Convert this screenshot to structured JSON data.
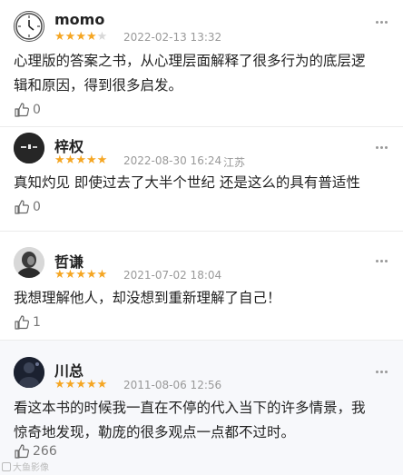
{
  "reviews": [
    {
      "user": "momo",
      "avatar_icon": "clock-icon",
      "rating": 4,
      "date": "2022-02-13 13:32",
      "location": "",
      "text_lines": [
        "心理版的答案之书，从心理层面解释了很多行为的底层逻",
        "辑和原因，得到很多启发。"
      ],
      "likes": "0"
    },
    {
      "user": "梓权",
      "avatar_icon": "dark-photo-avatar",
      "rating": 5,
      "date": "2022-08-30 16:24",
      "location": "江苏",
      "text_lines": [
        "真知灼见 即使过去了大半个世纪 还是这么的具有普适性"
      ],
      "likes": "0"
    },
    {
      "user": "哲谦",
      "avatar_icon": "portrait-avatar",
      "rating": 5,
      "date": "2021-07-02 18:04",
      "location": "",
      "text_lines": [
        "我想理解他人，却没想到重新理解了自己！"
      ],
      "likes": "1"
    },
    {
      "user": "川总",
      "avatar_icon": "night-photo-avatar",
      "rating": 5,
      "date": "2011-08-06 12:56",
      "location": "",
      "text_lines": [
        "看这本书的时候我一直在不停的代入当下的许多情景，我",
        "惊奇地发现，勒庞的很多观点一点都不过时。"
      ],
      "likes": "266"
    }
  ],
  "colors": {
    "star": "#f5a623",
    "star_off": "#d8d8d8",
    "meta": "#999999",
    "alt_bg": "#f7f8fb"
  },
  "watermark": "大鱼影像"
}
